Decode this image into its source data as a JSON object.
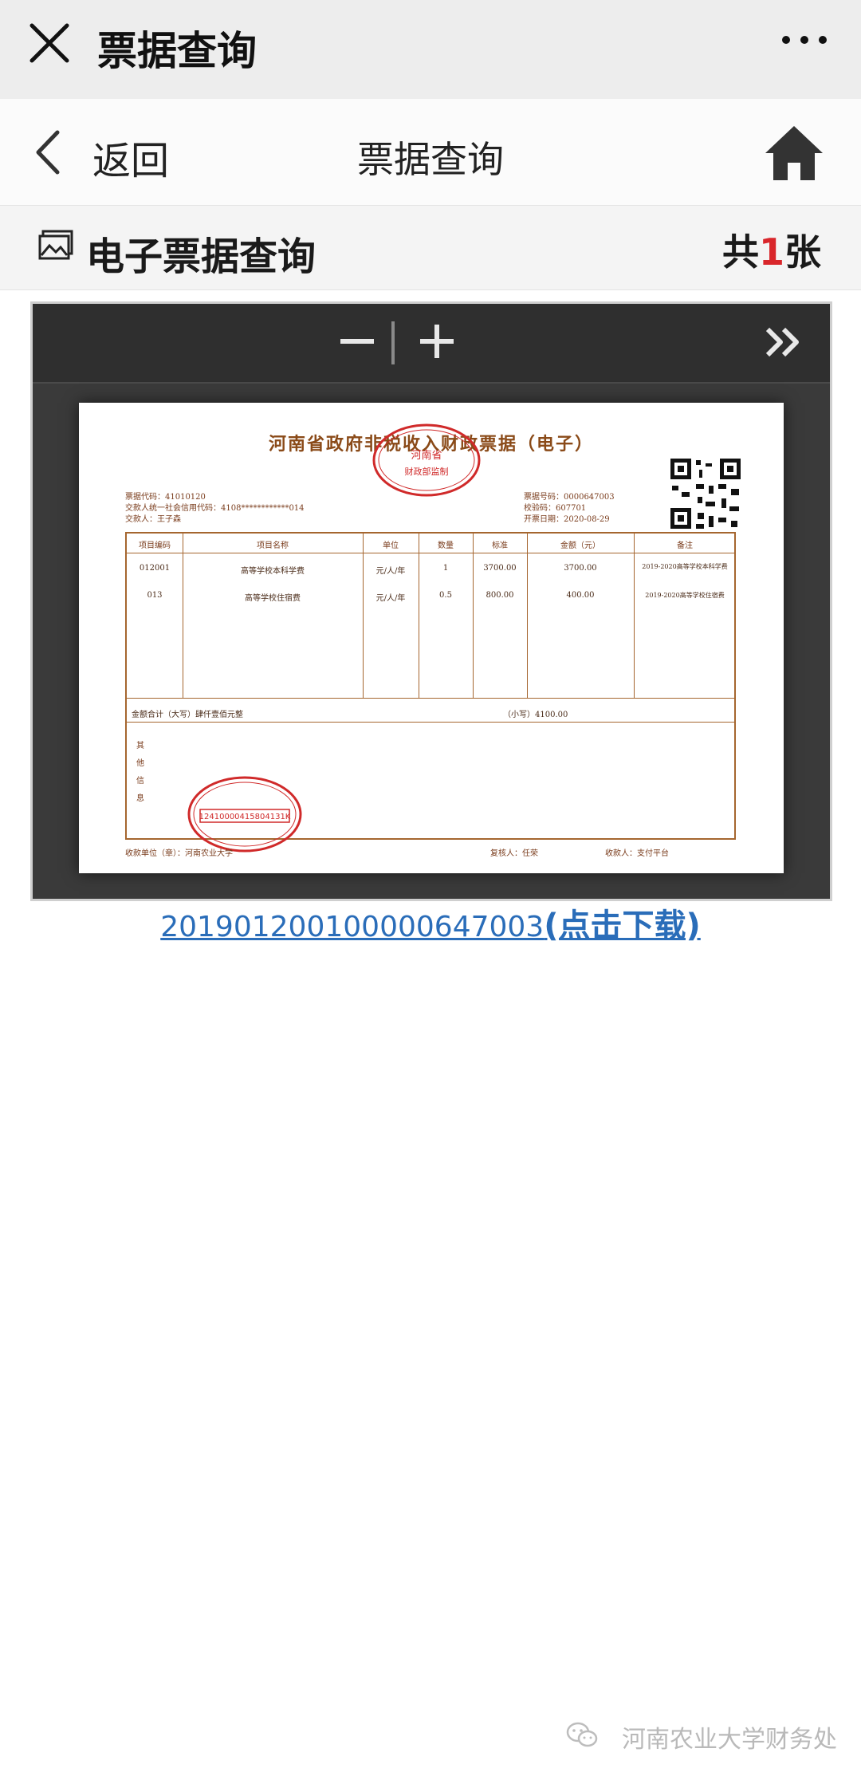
{
  "topbar": {
    "title": "票据查询",
    "close_icon": "close-icon",
    "more_icon": "more-dots-icon"
  },
  "navbar": {
    "back_label": "返回",
    "title": "票据查询",
    "home_icon": "home-icon"
  },
  "section": {
    "title": "电子票据查询",
    "count_prefix": "共",
    "count": "1",
    "count_suffix": "张"
  },
  "viewer": {
    "zoom_out": "−",
    "zoom_in": "+",
    "invoice": {
      "title": "河南省政府非税收入财政票据（电子）",
      "code": "票据代码：41010120",
      "payer_credit": "交款人统一社会信用代码：4108************014",
      "payer": "交款人：王子森",
      "number": "票据号码：0000647003",
      "check_code": "校验码：607701",
      "issue_date": "开票日期：2020-08-29",
      "headers": [
        "项目编码",
        "项目名称",
        "单位",
        "数量",
        "标准",
        "金额（元）",
        "备注"
      ],
      "rows": [
        {
          "code": "012001",
          "name": "高等学校本科学费",
          "unit": "元/人/年",
          "qty": "1",
          "std": "3700.00",
          "amount": "3700.00",
          "note": "2019-2020高等学校本科学费"
        },
        {
          "code": "013",
          "name": "高等学校住宿费",
          "unit": "元/人/年",
          "qty": "0.5",
          "std": "800.00",
          "amount": "400.00",
          "note": "2019-2020高等学校住宿费"
        }
      ],
      "total_upper": "金额合计（大写）肆仟壹佰元整",
      "total_lower": "（小写）4100.00",
      "other_info": "其他信息",
      "payee_unit": "收款单位（章）：河南农业大学",
      "reviewer": "复核人：任荣",
      "collector": "收款人：支付平台",
      "seal1_text": "河南省",
      "seal1_sub": "财政部监制",
      "seal2_code": "12410000415804131K"
    }
  },
  "download": {
    "number": "201901200100000647003",
    "action": "(点击下载)"
  },
  "watermark": "河南农业大学财务处"
}
